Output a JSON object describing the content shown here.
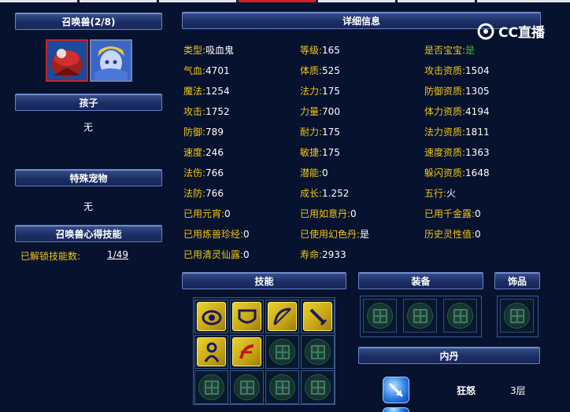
{
  "top_tabs": [
    "",
    "",
    "",
    "",
    "",
    ""
  ],
  "left_panel": {
    "summon_header": "召唤兽(2/8)",
    "child_header": "孩子",
    "child_value": "无",
    "special_header": "特殊宠物",
    "special_value": "无",
    "heart_skill_header": "召唤兽心得技能",
    "unlocked_label": "已解锁技能数:",
    "unlocked_value": "1/49"
  },
  "watermark": "CC直播",
  "details": {
    "header": "详细信息",
    "stats": [
      {
        "k": "类型:",
        "v": "吸血鬼"
      },
      {
        "k": "等级:",
        "v": "165"
      },
      {
        "k": "是否宝宝:",
        "v": "是"
      },
      {
        "k": "气血:",
        "v": "4701"
      },
      {
        "k": "体质:",
        "v": "525"
      },
      {
        "k": "攻击资质:",
        "v": "1504"
      },
      {
        "k": "魔法:",
        "v": "1254"
      },
      {
        "k": "法力:",
        "v": "175"
      },
      {
        "k": "防御资质:",
        "v": "1305"
      },
      {
        "k": "攻击:",
        "v": "1752"
      },
      {
        "k": "力量:",
        "v": "700"
      },
      {
        "k": "体力资质:",
        "v": "4194"
      },
      {
        "k": "防御:",
        "v": "789"
      },
      {
        "k": "耐力:",
        "v": "175"
      },
      {
        "k": "法力资质:",
        "v": "1811"
      },
      {
        "k": "速度:",
        "v": "246"
      },
      {
        "k": "敏捷:",
        "v": "175"
      },
      {
        "k": "速度资质:",
        "v": "1363"
      },
      {
        "k": "法伤:",
        "v": "766"
      },
      {
        "k": "潜能:",
        "v": "0"
      },
      {
        "k": "躲闪资质:",
        "v": "1648"
      },
      {
        "k": "法防:",
        "v": "766"
      },
      {
        "k": "成长:",
        "v": "1.252"
      },
      {
        "k": "五行:",
        "v": "火"
      },
      {
        "k": "已用元宵:",
        "v": "0"
      },
      {
        "k": "已用如意丹:",
        "v": "0"
      },
      {
        "k": "已用千金露:",
        "v": "0"
      },
      {
        "k": "已用炼兽珍经:",
        "v": "0"
      },
      {
        "k": "已使用幻色丹:",
        "v": "是"
      },
      {
        "k": "历史灵性值:",
        "v": "0"
      },
      {
        "k": "已用清灵仙露:",
        "v": "0"
      },
      {
        "k": "寿命:",
        "v": "2933"
      }
    ]
  },
  "skills": {
    "header": "技能"
  },
  "equipment": {
    "header": "装备"
  },
  "accessory": {
    "header": "饰品"
  },
  "neidan": {
    "header": "内丹",
    "items": [
      {
        "name": "狂怒",
        "level": "3层"
      }
    ]
  },
  "colors": {
    "label": "#f0c419",
    "value": "#ffffff",
    "yes_green": "#34c634",
    "background": "#06122e",
    "header_bg": "#1c2e64"
  }
}
